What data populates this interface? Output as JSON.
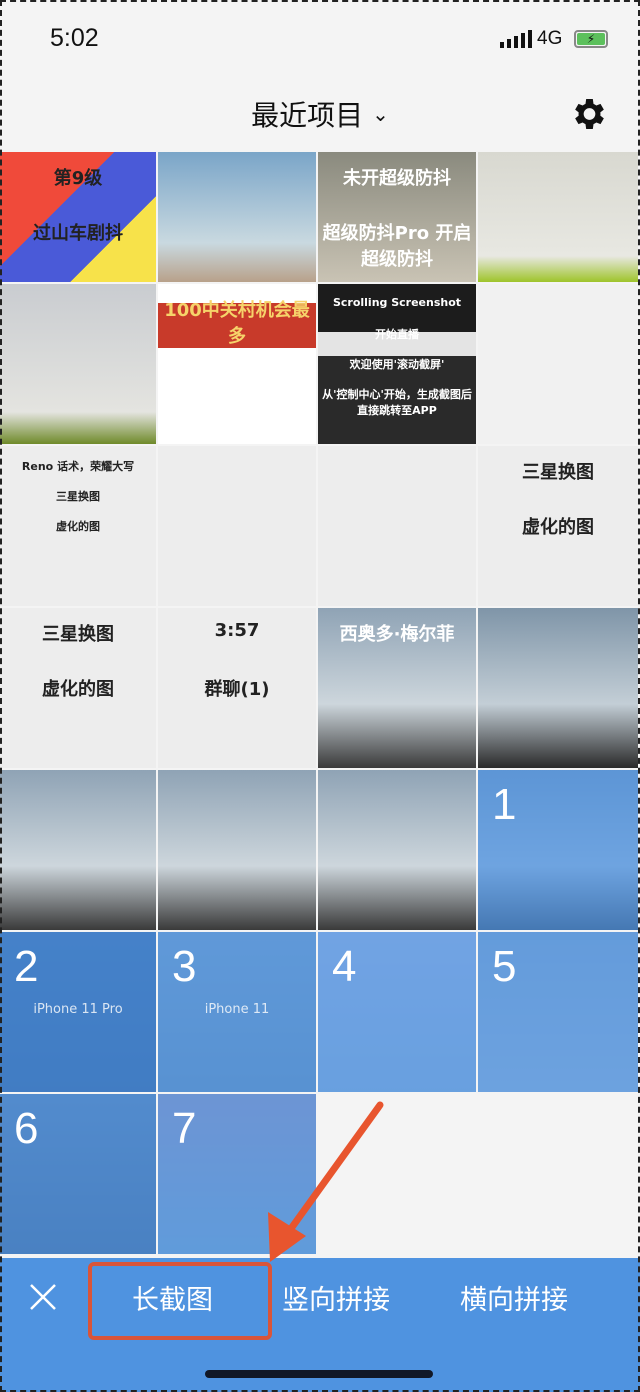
{
  "status": {
    "time": "5:02",
    "network": "4G",
    "battery_charging": true
  },
  "header": {
    "title": "最近项目",
    "icons": [
      "chevron-down-icon",
      "gear-icon"
    ]
  },
  "tiles": [
    {
      "bg": "linear-gradient(135deg,#f04a3a 0 40%,#4a5ad8 40% 70%,#f7e24a 70%)",
      "caps": [
        "第9级",
        "过山车剧抖"
      ],
      "capColor": "#222"
    },
    {
      "bg": "linear-gradient(180deg,#7aa5c8,#c9d9e0 70%,#b8a18a)",
      "caps": []
    },
    {
      "bg": "linear-gradient(180deg,#8a8a7e,#c9c3b4)",
      "caps": [
        "未开超级防抖",
        "超级防抖Pro  开启超级防抖"
      ],
      "capColor": "#fff"
    },
    {
      "bg": "linear-gradient(180deg,#d8d8d0,#e8e8e2 80%,#9ec42a)",
      "caps": []
    },
    {
      "bg": "linear-gradient(180deg,#c9ccd0,#e4e4e0 80%,#6f8a2a)",
      "caps": []
    },
    {
      "bg": "linear-gradient(180deg,#fff 0 12%,#c83a2a 12% 40%,#fff 40%)",
      "caps": [
        "100中关村机会最多"
      ],
      "capColor": "#f6d36a"
    },
    {
      "bg": "linear-gradient(180deg,#1c1c1c 0 30%,#e4e4e4 30% 45%,#2a2a2a 45%)",
      "caps": [
        "Scrolling Screenshot",
        "开始直播",
        "欢迎使用'滚动截屏'",
        "从'控制中心'开始，生成截图后直接跳转至APP"
      ],
      "capColor": "#fff"
    },
    {
      "bg": "#f1f1f1",
      "caps": []
    },
    {
      "bg": "#ededed",
      "caps": [
        "Reno 话术，荣耀大写",
        "三星换图",
        "虚化的图"
      ],
      "capColor": "#222"
    },
    {
      "bg": "#ededed",
      "caps": []
    },
    {
      "bg": "#ededed",
      "caps": []
    },
    {
      "bg": "#ededed",
      "caps": [
        "三星换图",
        "虚化的图"
      ],
      "capColor": "#222"
    },
    {
      "bg": "#ededed",
      "caps": [
        "三星换图",
        "虚化的图"
      ],
      "capColor": "#222"
    },
    {
      "bg": "#ededed",
      "caps": [
        "3:57",
        "群聊(1)"
      ],
      "capColor": "#222"
    },
    {
      "bg": "linear-gradient(180deg,#8fa3b5,#cdd6dc 60%,#3a3a3a)",
      "caps": [
        "西奥多·梅尔菲"
      ],
      "capColor": "#fff"
    },
    {
      "bg": "linear-gradient(180deg,#7f95a8,#c3ced6 60%,#2a2a2a)",
      "caps": []
    },
    {
      "bg": "linear-gradient(180deg,#8fa3b5,#cdd6dc 60%,#3a3a3a)",
      "caps": []
    },
    {
      "bg": "linear-gradient(180deg,#8fa3b5,#cdd6dc 60%,#3a3a3a)",
      "caps": []
    },
    {
      "bg": "linear-gradient(180deg,#8fa3b5,#cdd6dc 60%,#3a3a3a)",
      "caps": []
    },
    {
      "bg": "linear-gradient(180deg,#8fa3b5,#cdd6dc 60%,#3a3a3a)",
      "sel": "1",
      "caps": []
    },
    {
      "bg": "linear-gradient(180deg,#3a5c8a,#2b4a74)",
      "sel": "2",
      "sub": "iPhone 11 Pro",
      "caps": []
    },
    {
      "bg": "linear-gradient(180deg,#9ab0c0,#7d96a8)",
      "sel": "3",
      "sub": "iPhone 11",
      "caps": []
    },
    {
      "bg": "linear-gradient(180deg,#d8d4e8,#b8c8d8)",
      "sel": "4",
      "caps": []
    },
    {
      "bg": "linear-gradient(180deg,#a8b8c8,#c8d0d8)",
      "sel": "5",
      "caps": []
    },
    {
      "bg": "linear-gradient(180deg,#6a7f98,#4a5a70)",
      "sel": "6",
      "caps": []
    },
    {
      "bg": "linear-gradient(180deg,#c8a0b0,#9ab8c8)",
      "sel": "7",
      "caps": []
    },
    {
      "bg": "#f4f4f4",
      "caps": []
    },
    {
      "bg": "#f4f4f4",
      "caps": []
    }
  ],
  "bottom": {
    "close_icon": "close-icon",
    "long_screenshot": "长截图",
    "vertical_stitch": "竖向拼接",
    "horizontal_stitch": "横向拼接",
    "accent": "#4f93e0",
    "highlight": "#d9553a",
    "arrow": "#e8552e"
  }
}
